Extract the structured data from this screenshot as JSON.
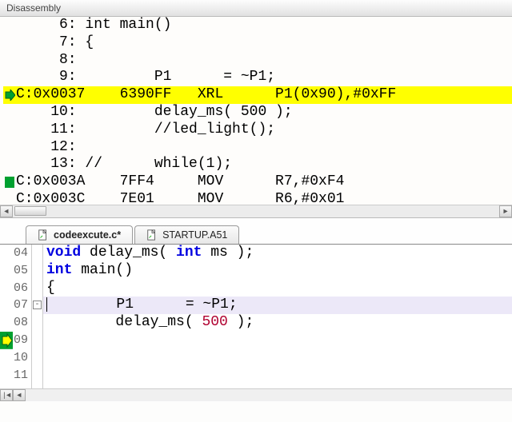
{
  "panel_title": "Disassembly",
  "disasm": {
    "lines": [
      {
        "text": "     6: int main() "
      },
      {
        "text": "     7: { "
      },
      {
        "text": "     8:  "
      },
      {
        "text": "     9:         P1      = ~P1; "
      },
      {
        "text": "C:0x0037    6390FF   XRL      P1(0x90),#0xFF",
        "current": true
      },
      {
        "text": "    10:         delay_ms( 500 ); "
      },
      {
        "text": "    11:         //led_light();  "
      },
      {
        "text": "    12:  "
      },
      {
        "text": "    13: //      while(1); "
      },
      {
        "text": "C:0x003A    7FF4     MOV      R7,#0xF4",
        "bp": true
      },
      {
        "text": "C:0x003C    7E01     MOV      R6,#0x01"
      }
    ]
  },
  "tabs": [
    {
      "label": "codeexcute.c*",
      "active": true
    },
    {
      "label": "STARTUP.A51",
      "active": false
    }
  ],
  "editor": {
    "lines": [
      {
        "n": "04",
        "tokens": [
          [
            "kw",
            "void"
          ],
          [
            "",
            " delay_ms( "
          ],
          [
            "kw",
            "int"
          ],
          [
            "",
            " ms );"
          ]
        ]
      },
      {
        "n": "05",
        "tokens": [
          [
            "",
            ""
          ]
        ]
      },
      {
        "n": "06",
        "tokens": [
          [
            "kw",
            "int"
          ],
          [
            "",
            " main()"
          ]
        ]
      },
      {
        "n": "07",
        "tokens": [
          [
            "",
            "{"
          ]
        ],
        "fold": true
      },
      {
        "n": "08",
        "tokens": [
          [
            "",
            ""
          ]
        ]
      },
      {
        "n": "09",
        "tokens": [
          [
            "",
            "        P1      = ~P1;"
          ]
        ],
        "current": true,
        "exec": true
      },
      {
        "n": "10",
        "tokens": [
          [
            "",
            "        delay_ms( "
          ],
          [
            "num-lit",
            "500"
          ],
          [
            "",
            " );"
          ]
        ]
      },
      {
        "n": "11",
        "tokens": [
          [
            "",
            ""
          ]
        ]
      }
    ]
  },
  "icons": {
    "tab_file": "file-icon"
  }
}
